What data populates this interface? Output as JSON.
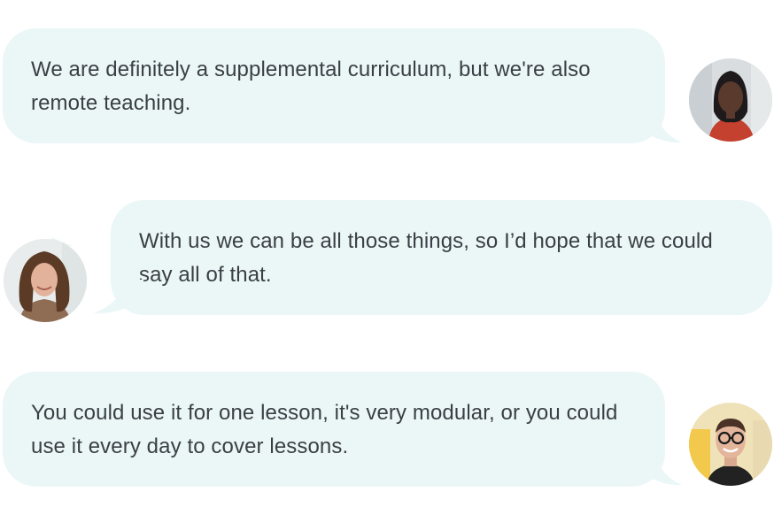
{
  "messages": [
    {
      "text": "We are definitely a supplemental curriculum, but we're also remote teaching.",
      "avatar": "woman-dark-hair-red-top-avatar"
    },
    {
      "text": "With us we can be all those things, so I’d hope that we could say all of that.",
      "avatar": "woman-brown-hair-avatar"
    },
    {
      "text": "You could use it for one lesson, it's very modular, or you could use it every day to cover lessons.",
      "avatar": "man-glasses-avatar"
    }
  ],
  "colors": {
    "bubble": "#ebf7f7",
    "text": "#3a3f45"
  }
}
